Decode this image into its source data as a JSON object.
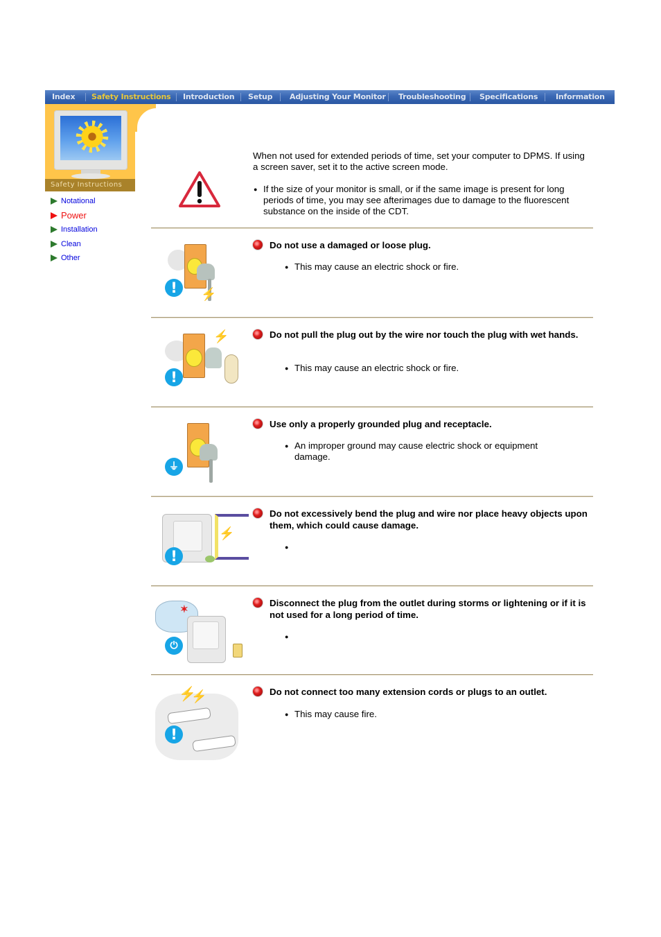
{
  "nav": {
    "items": [
      {
        "label": "Index",
        "active": false
      },
      {
        "label": "Safety Instructions",
        "active": true
      },
      {
        "label": "Introduction",
        "active": false
      },
      {
        "label": "Setup",
        "active": false
      },
      {
        "label": "Adjusting Your Monitor",
        "active": false
      },
      {
        "label": "Troubleshooting",
        "active": false
      },
      {
        "label": "Specifications",
        "active": false
      },
      {
        "label": "Information",
        "active": false
      }
    ],
    "colors": {
      "bar": "#3a68b4",
      "active_text": "#e8c83a",
      "text": "#dfe6f2"
    }
  },
  "sidebar": {
    "logo_caption": "Safety Instructions",
    "items": [
      {
        "label": "Notational",
        "active": false
      },
      {
        "label": "Power",
        "active": true
      },
      {
        "label": "Installation",
        "active": false
      },
      {
        "label": "Clean",
        "active": false
      },
      {
        "label": "Other",
        "active": false
      }
    ],
    "colors": {
      "link": "#0000dd",
      "active": "#ee1111",
      "arrow": "#2d7a2d",
      "logo_bg": "#ffc54a"
    }
  },
  "intro": {
    "icon": "warning-triangle-icon",
    "paragraph": "When not used for extended periods of time, set your computer to DPMS. If using a screen saver, set it to the active screen mode.",
    "bullet": "If the size of your monitor is small, or if the same image is present for long periods of time, you may see afterimages due to damage to the fluorescent substance on the inside of the CDT."
  },
  "sections": [
    {
      "title": "Do not use a damaged or loose plug.",
      "bullet": "This may cause an electric shock or fire.",
      "icon": "damaged-plug-illustration",
      "badge": "exclamation-icon"
    },
    {
      "title": "Do not pull the plug out by the wire nor touch the plug with wet hands.",
      "bullet": "This may cause an electric shock or fire.",
      "icon": "wet-hands-plug-illustration",
      "badge": "exclamation-icon"
    },
    {
      "title": "Use only a properly grounded plug and receptacle.",
      "bullet": "An improper ground may cause electric shock or equipment damage.",
      "icon": "grounded-plug-illustration",
      "badge": "ground-icon"
    },
    {
      "title": "Do not excessively bend the plug and wire nor place heavy objects upon them, which could cause damage.",
      "bullet": "",
      "icon": "bent-wire-monitor-illustration",
      "badge": "exclamation-icon"
    },
    {
      "title": "Disconnect the plug from the outlet during storms or lightening or if it is not used for a long period of time.",
      "bullet": "",
      "icon": "storm-unplug-illustration",
      "badge": "unplug-icon"
    },
    {
      "title": "Do not connect too many extension cords or plugs to an outlet.",
      "bullet": "This may cause fire.",
      "icon": "overloaded-outlet-illustration",
      "badge": "exclamation-icon"
    }
  ]
}
